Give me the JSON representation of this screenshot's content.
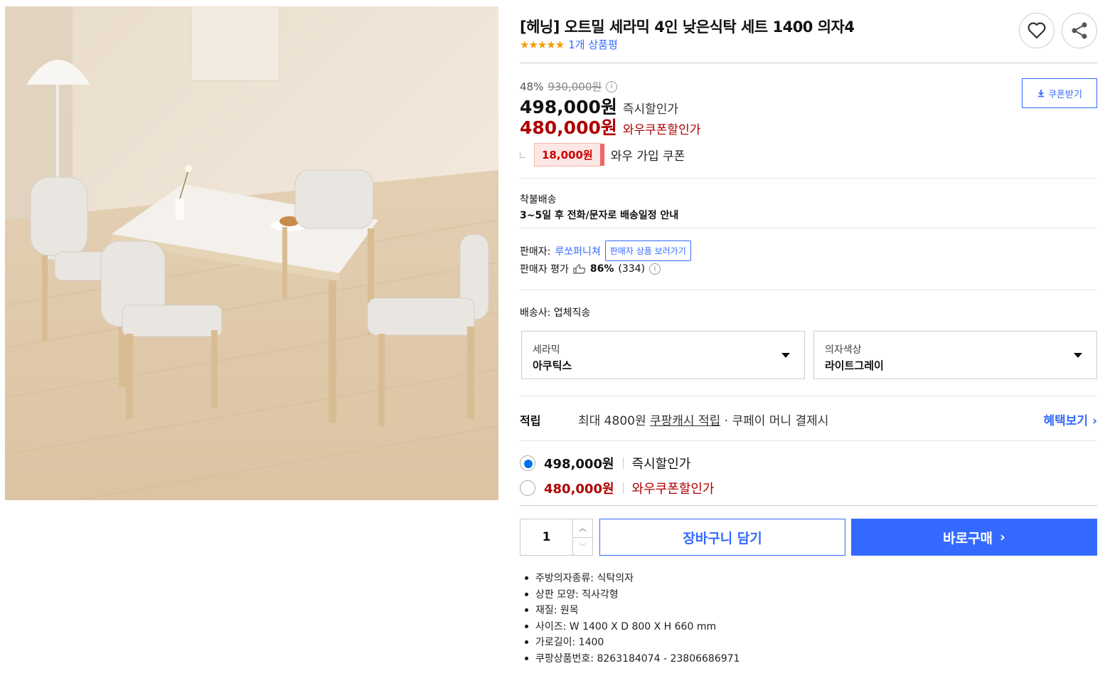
{
  "product": {
    "title": "[헤닝] 오트밀 세라믹 4인 낮은식탁 세트 1400 의자4",
    "stars": "★★★★★",
    "rating_value": 5,
    "review_link": "1개 상품평"
  },
  "pricing": {
    "discount_rate": "48%",
    "original_price": "930,000원",
    "instant_price": "498,000원",
    "instant_label": "즉시할인가",
    "wow_price": "480,000원",
    "wow_label": "와우쿠폰할인가",
    "coupon_button": "쿠폰받기",
    "wow_coupon_amount": "18,000원",
    "wow_coupon_label": "와우 가입 쿠폰"
  },
  "shipping": {
    "type": "착불배송",
    "note": "3~5일 후 전화/문자로 배송일정 안내",
    "seller_prefix": "판매자:",
    "seller_name": "루쏘퍼니쳐",
    "seller_button": "판매자 상품 보러가기",
    "seller_rating_label": "판매자 평가",
    "seller_rating_pct": "86%",
    "seller_rating_count": "(334)",
    "delivery_company": "배송사: 업체직송"
  },
  "options": [
    {
      "key": "세라믹",
      "value": "아쿠틱스"
    },
    {
      "key": "의자색상",
      "value": "라이트그레이"
    }
  ],
  "reward": {
    "label": "적립",
    "text_pre": "최대 4800원 ",
    "text_link": "쿠팡캐시 적립",
    "text_post": " · 쿠페이 머니 결제시",
    "more": "혜택보기 ›"
  },
  "price_options": [
    {
      "amount": "498,000원",
      "label": "즉시할인가",
      "selected": true
    },
    {
      "amount": "480,000원",
      "label": "와우쿠폰할인가",
      "selected": false
    }
  ],
  "purchase": {
    "quantity": "1",
    "cart_button": "장바구니 담기",
    "buy_button": "바로구매",
    "buy_arrow": "›"
  },
  "specs": [
    "주방의자종류: 식탁의자",
    "상판 모양: 직사각형",
    "재질: 원목",
    "사이즈: W 1400 X D 800 X H 660 mm",
    "가로길이: 1400",
    "쿠팡상품번호: 8263184074 - 23806686971"
  ],
  "colors": {
    "accent_blue": "#346aff",
    "price_red": "#ae0000",
    "star": "#f59b00",
    "radio_blue": "#0073e9"
  }
}
